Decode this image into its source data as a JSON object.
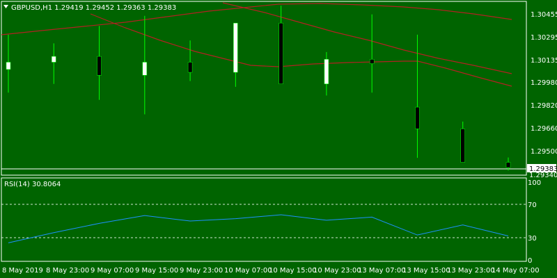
{
  "header": {
    "symbol_line": "GBPUSD,H1  1.29419 1.29452 1.29363 1.29383"
  },
  "colors": {
    "background": "#006400",
    "frame": "#ffffff",
    "bull": "#ffffff",
    "bear": "#000000",
    "wick": "#00ff00",
    "ma": "#b22222",
    "rsi": "#1e90ff",
    "grid": "#cfe6cf"
  },
  "icons": {
    "collapse": "triangle-down-icon"
  },
  "price_panel": {
    "y_ticks": [
      "1.30455",
      "1.30295",
      "1.30135",
      "1.29980",
      "1.29820",
      "1.29660",
      "1.29500"
    ],
    "current_price_label": "1.29383",
    "lower_label": "1.29340"
  },
  "rsi_panel": {
    "label": "RSI(14) 30.8064",
    "y_ticks": [
      "100",
      "70",
      "30",
      "0"
    ]
  },
  "time_axis": [
    "8 May 2019",
    "8 May 23:00",
    "9 May 07:00",
    "9 May 15:00",
    "9 May 23:00",
    "10 May 07:00",
    "10 May 15:00",
    "10 May 23:00",
    "13 May 07:00",
    "13 May 15:00",
    "13 May 23:00",
    "14 May 07:00"
  ],
  "chart_data": [
    {
      "type": "candlestick",
      "title": "GBPUSD,H1",
      "y_range": [
        1.2934,
        1.3052
      ],
      "x": [
        "8 May 2019",
        "8 May 23:00",
        "9 May 07:00",
        "9 May 15:00",
        "9 May 23:00",
        "10 May 07:00",
        "10 May 15:00",
        "10 May 23:00",
        "13 May 07:00",
        "13 May 15:00",
        "13 May 23:00",
        "14 May 07:00"
      ],
      "open": [
        1.3006,
        1.3011,
        1.3015,
        1.3002,
        1.3011,
        1.3004,
        1.3038,
        1.2996,
        1.3013,
        1.298,
        1.2965,
        1.29419
      ],
      "high": [
        1.303,
        1.3024,
        1.3036,
        1.3043,
        1.3026,
        1.3037,
        1.305,
        1.3018,
        1.3044,
        1.303,
        1.297,
        1.29452
      ],
      "low": [
        1.299,
        1.2996,
        1.2985,
        1.2975,
        1.2998,
        1.2994,
        1.3005,
        1.2988,
        1.299,
        1.2945,
        1.2947,
        1.29363
      ],
      "close": [
        1.3011,
        1.3015,
        1.3002,
        1.3011,
        1.3004,
        1.3038,
        1.2996,
        1.3013,
        1.301,
        1.2965,
        1.29419,
        1.29383
      ]
    },
    {
      "type": "line",
      "title": "RSI(14)",
      "y_range": [
        0,
        100
      ],
      "levels": [
        70,
        30
      ],
      "x": [
        "8 May 2019",
        "8 May 23:00",
        "9 May 07:00",
        "9 May 15:00",
        "9 May 23:00",
        "10 May 07:00",
        "10 May 15:00",
        "10 May 23:00",
        "13 May 07:00",
        "13 May 15:00",
        "13 May 23:00",
        "14 May 07:00"
      ],
      "series": [
        {
          "values": [
            22,
            35,
            47,
            57,
            50,
            53,
            58,
            51,
            55,
            32,
            45,
            30.8064
          ]
        }
      ]
    }
  ]
}
